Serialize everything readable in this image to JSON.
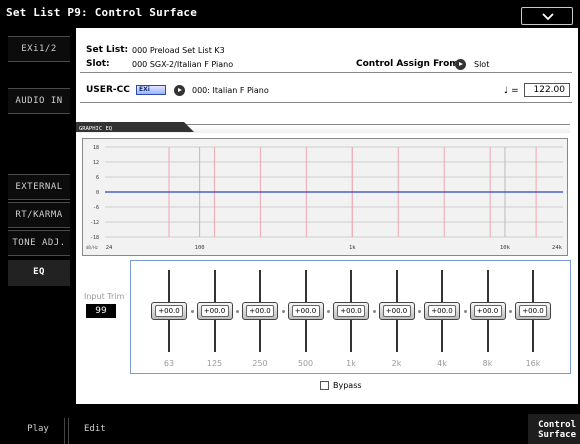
{
  "window": {
    "title": "Set List P9: Control Surface"
  },
  "left_tabs": [
    {
      "label": "EXi1/2",
      "active": false
    },
    {
      "label": "AUDIO IN",
      "active": false
    },
    {
      "label": "EXTERNAL",
      "active": false
    },
    {
      "label": "RT/KARMA",
      "active": false
    },
    {
      "label": "TONE ADJ.",
      "active": false
    },
    {
      "label": "EQ",
      "active": true
    }
  ],
  "info": {
    "set_list_label": "Set List:",
    "set_list_value": "000 Preload Set List K3",
    "slot_label": "Slot:",
    "slot_value": "000 SGX-2/Italian F Piano",
    "control_assign_label": "Control Assign From:",
    "control_assign_value": "Slot",
    "user_cc_label": "USER-CC",
    "exi_badge": "EXi",
    "program_value": "000: Italian F Piano",
    "tempo_symbol": "♩ =",
    "tempo_value": "122.00"
  },
  "graphic_eq": {
    "tab_label": "GRAPHIC EQ",
    "y_ticks": [
      "18",
      "12",
      "6",
      "0",
      "-6",
      "-12",
      "-18"
    ],
    "unit_label": "dB/Hz",
    "x_ticks": [
      "24",
      "100",
      "1k",
      "10k",
      "24k"
    ]
  },
  "input_trim": {
    "label": "Input Trim",
    "value": "99"
  },
  "bands": [
    {
      "freq": "63",
      "gain": "+00.0"
    },
    {
      "freq": "125",
      "gain": "+00.0"
    },
    {
      "freq": "250",
      "gain": "+00.0"
    },
    {
      "freq": "500",
      "gain": "+00.0"
    },
    {
      "freq": "1k",
      "gain": "+00.0"
    },
    {
      "freq": "2k",
      "gain": "+00.0"
    },
    {
      "freq": "4k",
      "gain": "+00.0"
    },
    {
      "freq": "8k",
      "gain": "+00.0"
    },
    {
      "freq": "16k",
      "gain": "+00.0"
    }
  ],
  "bypass": {
    "label": "Bypass",
    "checked": false
  },
  "bottom_tabs": [
    {
      "label": "Play"
    },
    {
      "label": "Edit"
    },
    {
      "label_line1": "Control",
      "label_line2": "Surface"
    }
  ],
  "colors": {
    "accent_blue": "#2a45b8",
    "band_line_pink": "#f2a6b2",
    "panel_border_blue": "#7a9bd2"
  }
}
